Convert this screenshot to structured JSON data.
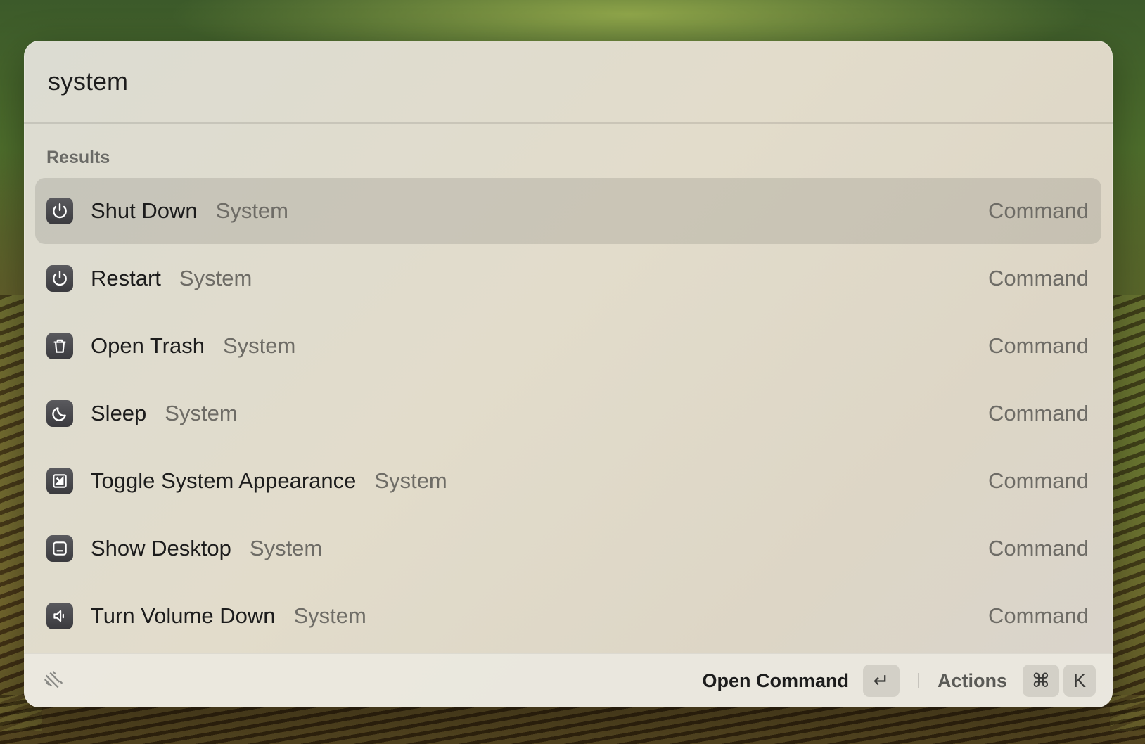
{
  "search": {
    "value": "system"
  },
  "section": {
    "label": "Results"
  },
  "results": [
    {
      "title": "Shut Down",
      "subtitle": "System",
      "type": "Command",
      "icon": "power-icon"
    },
    {
      "title": "Restart",
      "subtitle": "System",
      "type": "Command",
      "icon": "power-icon"
    },
    {
      "title": "Open Trash",
      "subtitle": "System",
      "type": "Command",
      "icon": "trash-icon"
    },
    {
      "title": "Sleep",
      "subtitle": "System",
      "type": "Command",
      "icon": "moon-icon"
    },
    {
      "title": "Toggle System Appearance",
      "subtitle": "System",
      "type": "Command",
      "icon": "appearance-icon"
    },
    {
      "title": "Show Desktop",
      "subtitle": "System",
      "type": "Command",
      "icon": "desktop-icon"
    },
    {
      "title": "Turn Volume Down",
      "subtitle": "System",
      "type": "Command",
      "icon": "volume-down-icon"
    }
  ],
  "footer": {
    "primary_action": "Open Command",
    "enter_key": "↵",
    "secondary_action": "Actions",
    "cmd_key": "⌘",
    "k_key": "K"
  },
  "colors": {
    "panel": "#e0dbcc",
    "selected_row": "#c4c0b4",
    "icon_bg": "#48484c"
  }
}
